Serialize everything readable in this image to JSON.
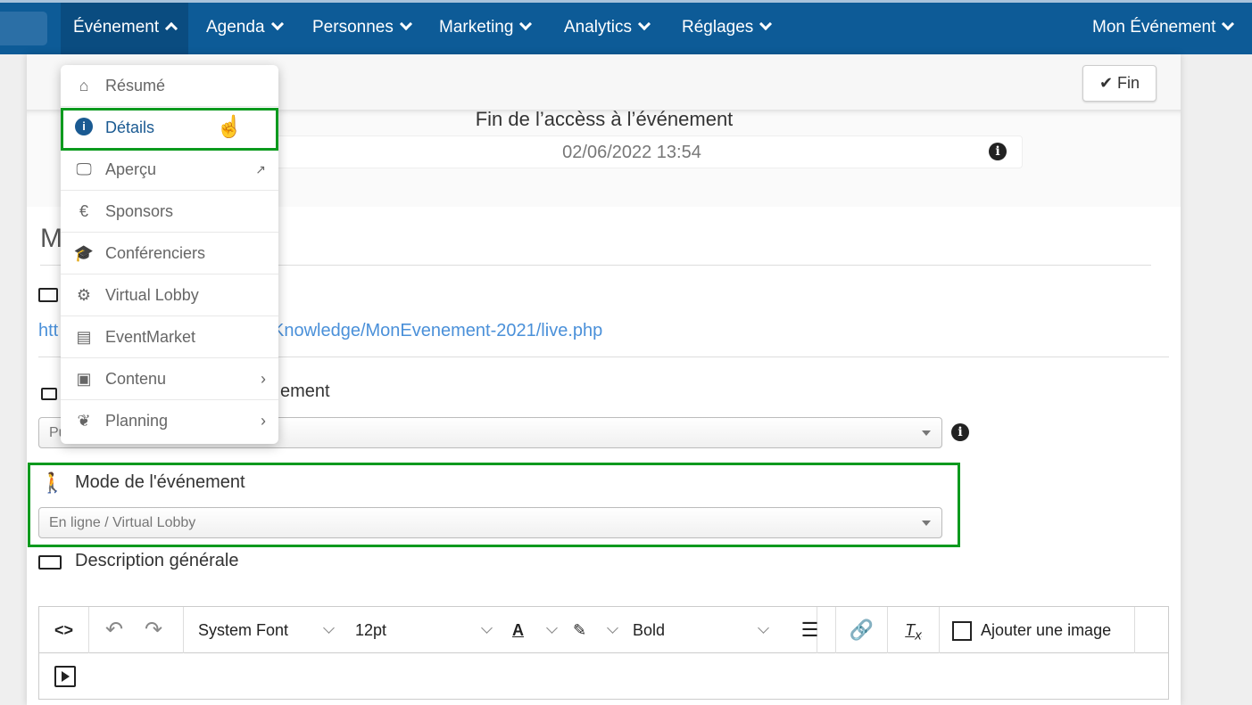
{
  "nav": {
    "items": [
      {
        "label": "Événement",
        "open": true
      },
      {
        "label": "Agenda"
      },
      {
        "label": "Personnes"
      },
      {
        "label": "Marketing"
      },
      {
        "label": "Analytics"
      },
      {
        "label": "Réglages"
      }
    ],
    "right": "Mon Événement",
    "color": "#0d5b97"
  },
  "top": {
    "fin_button": "Fin",
    "end_title": "Fin de l’accèss à l’événement",
    "end_date": "02/06/2022 13:54"
  },
  "section": {
    "heading_fragment": "M",
    "link_prefix": "htt",
    "link_suffix": "Knowledge/MonEvenement-2021/live.php",
    "access_label_fragment": "ement",
    "access_select_fragment": "Pu"
  },
  "mode": {
    "label": "Mode de l'événement",
    "value": "En ligne / Virtual Lobby"
  },
  "description": {
    "label": "Description générale"
  },
  "editor": {
    "font": "System Font",
    "size": "12pt",
    "format": "Bold",
    "add_image": "Ajouter une image"
  },
  "menu": {
    "items": [
      {
        "label": "Résumé",
        "icon": "home-icon",
        "glyph": "⌂"
      },
      {
        "label": "Détails",
        "icon": "info-icon",
        "glyph": "i",
        "selected": true
      },
      {
        "label": "Aperçu",
        "icon": "monitor-icon",
        "glyph": "🖵",
        "external": true
      },
      {
        "label": "Sponsors",
        "icon": "euro-icon",
        "glyph": "€"
      },
      {
        "label": "Conférenciers",
        "icon": "graduation-cap-icon",
        "glyph": "🎓"
      },
      {
        "label": "Virtual Lobby",
        "icon": "gears-icon",
        "glyph": "⚙"
      },
      {
        "label": "EventMarket",
        "icon": "store-icon",
        "glyph": "▤"
      },
      {
        "label": "Contenu",
        "icon": "images-icon",
        "glyph": "▣",
        "submenu": true
      },
      {
        "label": "Planning",
        "icon": "leaf-icon",
        "glyph": "❦",
        "submenu": true
      }
    ]
  },
  "highlight_color": "#0b9a1e"
}
